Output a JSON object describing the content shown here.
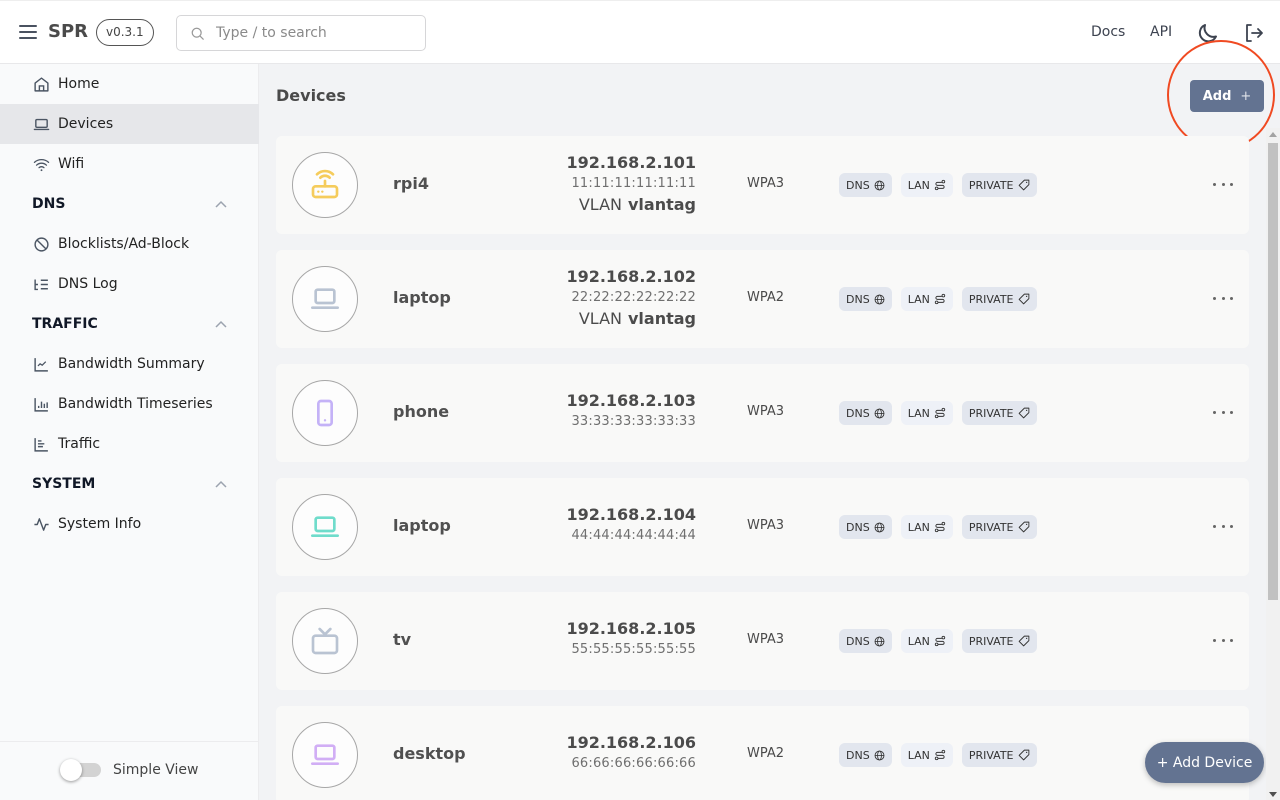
{
  "header": {
    "brand": "SPR",
    "version": "v0.3.1",
    "search_placeholder": "Type / to search",
    "links": {
      "docs": "Docs",
      "api": "API"
    }
  },
  "sidebar": {
    "items": [
      {
        "label": "Home",
        "icon": "home-icon"
      },
      {
        "label": "Devices",
        "icon": "laptop-icon",
        "active": true
      },
      {
        "label": "Wifi",
        "icon": "wifi-icon"
      }
    ],
    "sections": [
      {
        "title": "DNS",
        "items": [
          {
            "label": "Blocklists/Ad-Block",
            "icon": "ban-icon"
          },
          {
            "label": "DNS Log",
            "icon": "list-icon"
          }
        ]
      },
      {
        "title": "TRAFFIC",
        "items": [
          {
            "label": "Bandwidth Summary",
            "icon": "line-chart-icon"
          },
          {
            "label": "Bandwidth Timeseries",
            "icon": "bar-chart-icon"
          },
          {
            "label": "Traffic",
            "icon": "bar-chart-horizontal-icon"
          }
        ]
      },
      {
        "title": "SYSTEM",
        "items": [
          {
            "label": "System Info",
            "icon": "activity-icon"
          }
        ]
      }
    ],
    "footer": {
      "toggle_label": "Simple View",
      "toggle_on": false
    }
  },
  "main": {
    "title": "Devices",
    "add_label": "Add",
    "fab_label": "+ Add Device",
    "badge_labels": {
      "dns": "DNS",
      "lan": "LAN",
      "private": "PRIVATE"
    },
    "devices": [
      {
        "name": "rpi4",
        "ip": "192.168.2.101",
        "mac": "11:11:11:11:11:11",
        "vlan_label": "VLAN",
        "vlan": "vlantag",
        "auth": "WPA3",
        "icon": "router-icon",
        "color": "#f5cc5c"
      },
      {
        "name": "laptop",
        "ip": "192.168.2.102",
        "mac": "22:22:22:22:22:22",
        "vlan_label": "VLAN",
        "vlan": "vlantag",
        "auth": "WPA2",
        "icon": "laptop-icon",
        "color": "#b9c3d2"
      },
      {
        "name": "phone",
        "ip": "192.168.2.103",
        "mac": "33:33:33:33:33:33",
        "auth": "WPA3",
        "icon": "phone-icon",
        "color": "#c4b2f7"
      },
      {
        "name": "laptop",
        "ip": "192.168.2.104",
        "mac": "44:44:44:44:44:44",
        "auth": "WPA3",
        "icon": "laptop-icon",
        "color": "#6fdccb"
      },
      {
        "name": "tv",
        "ip": "192.168.2.105",
        "mac": "55:55:55:55:55:55",
        "auth": "WPA3",
        "icon": "tv-icon",
        "color": "#b9c3d2"
      },
      {
        "name": "desktop",
        "ip": "192.168.2.106",
        "mac": "66:66:66:66:66:66",
        "auth": "WPA2",
        "icon": "laptop-icon",
        "color": "#d1aef5"
      }
    ]
  }
}
